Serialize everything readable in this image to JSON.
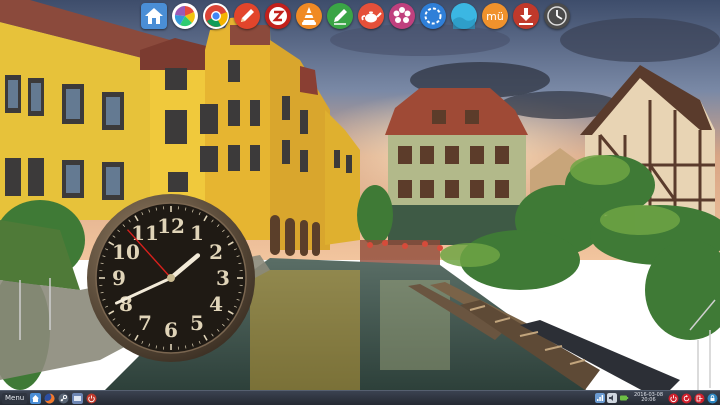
{
  "desktop": {
    "wallpaper": "colmar-canal-town-scene",
    "dock": {
      "items": [
        {
          "name": "home",
          "icon": "home-icon",
          "color": "#4a8ed6"
        },
        {
          "name": "picasa",
          "icon": "pinwheel-icon",
          "color": "#ffffff"
        },
        {
          "name": "chrome",
          "icon": "chrome-icon",
          "color": "#ffffff"
        },
        {
          "name": "editor",
          "icon": "pencil-icon",
          "color": "#e2452b"
        },
        {
          "name": "filezilla",
          "icon": "filezilla-icon",
          "color": "#c2201c"
        },
        {
          "name": "vlc",
          "icon": "vlc-cone-icon",
          "color": "#f08a24"
        },
        {
          "name": "text-editor",
          "icon": "green-pencil-icon",
          "color": "#3aa546"
        },
        {
          "name": "teapot",
          "icon": "teapot-icon",
          "color": "#e5503a"
        },
        {
          "name": "settings",
          "icon": "flower-gear-icon",
          "color": "#c0407e"
        },
        {
          "name": "screenshot",
          "icon": "dashed-circle-icon",
          "color": "#2f7fd8"
        },
        {
          "name": "wave",
          "icon": "wave-icon",
          "color": "#3bb7e3"
        },
        {
          "name": "mu",
          "icon": "mu-icon",
          "color": "#f0922c",
          "label": "mü"
        },
        {
          "name": "installer",
          "icon": "download-icon",
          "color": "#c0392b"
        },
        {
          "name": "clock",
          "icon": "clock-icon",
          "color": "#4b4b4b"
        }
      ]
    },
    "clock_widget": {
      "numerals": [
        "12",
        "1",
        "2",
        "3",
        "4",
        "5",
        "6",
        "7",
        "8",
        "9",
        "10",
        "11"
      ],
      "time": {
        "hours": 1,
        "minutes": 40,
        "seconds": 53
      },
      "face_color": "#1f1a14",
      "numeral_color": "#e0d4b8",
      "second_hand_color": "#d8201c"
    }
  },
  "taskbar": {
    "menu_label": "Menu",
    "items": [
      {
        "icon": "home-folder-icon",
        "color": "#4a8ed6"
      },
      {
        "icon": "firefox-icon",
        "color": "#f2792a"
      },
      {
        "icon": "steam-icon",
        "color": "#596575"
      },
      {
        "icon": "files-icon",
        "color": "#6d86b3"
      },
      {
        "icon": "power-icon",
        "color": "#c0392b"
      }
    ],
    "tray": {
      "icons": [
        {
          "icon": "network-icon",
          "color": "#6b9bd1"
        },
        {
          "icon": "volume-icon",
          "color": "#cfd6df"
        },
        {
          "icon": "battery-icon",
          "color": "#6dbf45"
        }
      ],
      "date": "2016-03-08",
      "time": "20:06",
      "buttons": [
        {
          "icon": "power-off-icon",
          "color": "#d1202c"
        },
        {
          "icon": "restart-icon",
          "color": "#d1202c"
        },
        {
          "icon": "logout-icon",
          "color": "#d1202c"
        },
        {
          "icon": "lock-icon",
          "color": "#2e86c1"
        }
      ]
    }
  }
}
